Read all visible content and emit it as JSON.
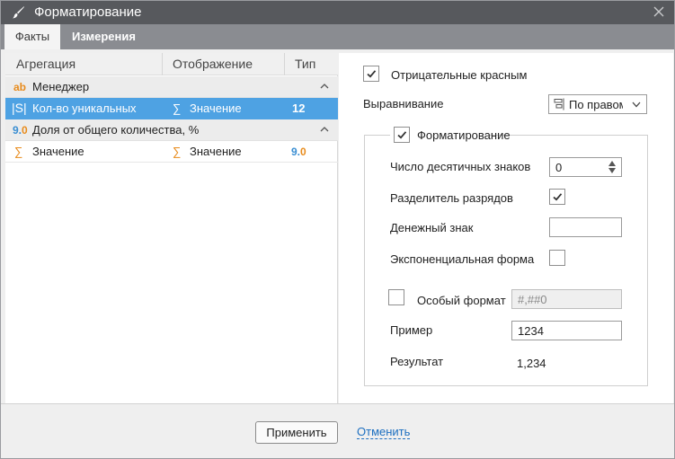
{
  "window": {
    "title": "Форматирование"
  },
  "tabs": [
    {
      "label": "Факты",
      "active": true
    },
    {
      "label": "Измерения",
      "active": false
    }
  ],
  "left": {
    "columns": [
      "Агрегация",
      "Отображение",
      "Тип"
    ],
    "rows": [
      {
        "kind": "group",
        "icon": "ab",
        "icon_name": "text-type-icon",
        "label": "Менеджер"
      },
      {
        "kind": "item",
        "selected": true,
        "icon": "|S|",
        "icon_name": "count-distinct-icon",
        "label": "Кол-во уникальных",
        "display_icon": "∑",
        "display": "Значение",
        "type": "12"
      },
      {
        "kind": "group",
        "icon_a": "9.",
        "icon_b": "0",
        "icon_name": "number-type-icon",
        "label": "Доля от общего количества, %"
      },
      {
        "kind": "item",
        "selected": false,
        "icon": "∑",
        "icon_name": "sum-icon",
        "label": "Значение",
        "display_icon": "∑",
        "display": "Значение",
        "type_a": "9.",
        "type_b": "0"
      }
    ]
  },
  "right": {
    "negative_red": {
      "label": "Отрицательные красным",
      "checked": true
    },
    "alignment": {
      "label": "Выравнивание",
      "value": "По правому",
      "icon_name": "align-right-icon"
    },
    "formatting": {
      "label": "Форматирование",
      "checked": true,
      "decimals": {
        "label": "Число десятичных знаков",
        "value": "0"
      },
      "thousands_sep": {
        "label": "Разделитель разрядов",
        "checked": true
      },
      "currency": {
        "label": "Денежный знак",
        "value": ""
      },
      "exponential": {
        "label": "Экспоненциальная форма",
        "checked": false
      },
      "custom_format": {
        "label": "Особый формат",
        "checked": false,
        "value": "#,##0"
      },
      "sample": {
        "label": "Пример",
        "value": "1234"
      },
      "result": {
        "label": "Результат",
        "value": "1,234"
      }
    }
  },
  "footer": {
    "apply": "Применить",
    "cancel": "Отменить"
  },
  "colors": {
    "titlebar": "#57595d",
    "tabbar": "#8a8c91",
    "selection": "#4ea2e3",
    "accent_orange": "#e88b1c",
    "link": "#1c6fc0"
  }
}
